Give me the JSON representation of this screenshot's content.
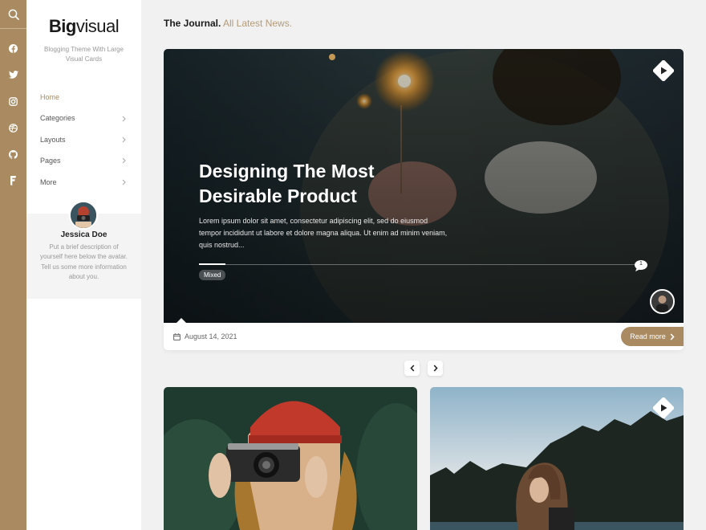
{
  "rail": {
    "icons": [
      "search-icon",
      "facebook-icon",
      "twitter-icon",
      "instagram-icon",
      "dribbble-icon",
      "github-icon",
      "foursquare-icon"
    ]
  },
  "sidebar": {
    "logo_bold": "Big",
    "logo_rest": "visual",
    "tagline": "Blogging Theme With Large Visual Cards",
    "menu": [
      {
        "label": "Home"
      },
      {
        "label": "Categories"
      },
      {
        "label": "Layouts"
      },
      {
        "label": "Pages"
      },
      {
        "label": "More"
      }
    ],
    "author": {
      "name": "Jessica Doe",
      "description": "Put a brief description of yourself here below the avatar. Tell us some more information about you."
    }
  },
  "main": {
    "heading_bold": "The Journal.",
    "heading_sub": "All Latest News.",
    "featured": {
      "title": "Designing The Most Desirable Product",
      "excerpt": "Lorem ipsum dolor sit amet, consectetur adipiscing elit, sed do eiusmod tempor incididunt ut labore et dolore magna aliqua. Ut enim ad minim veniam, quis nostrud...",
      "tag": "Mixed",
      "comment_count": "1",
      "date": "August 14, 2021",
      "read_more": "Read more"
    }
  },
  "colors": {
    "accent": "#a98a61",
    "rail": "#a98a61",
    "background": "#f1f1f1"
  }
}
